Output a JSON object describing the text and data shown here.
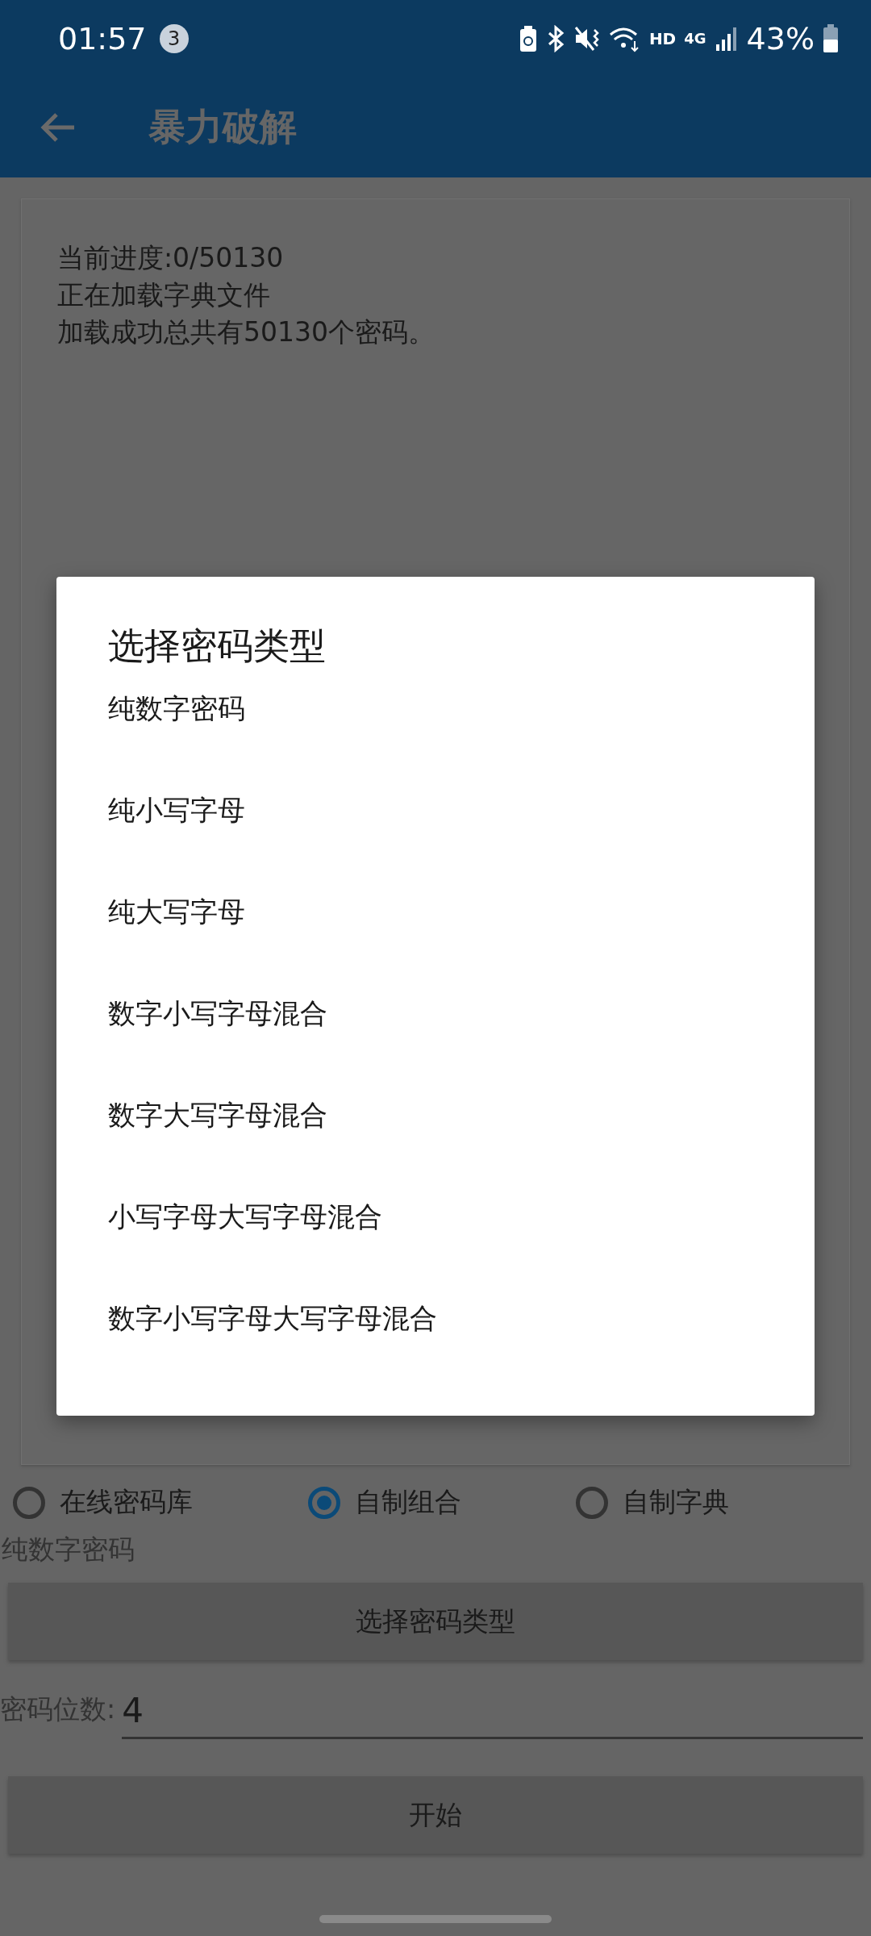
{
  "status_bar": {
    "time": "01:57",
    "notification_count": "3",
    "hd_label": "HD",
    "network_label": "4G",
    "battery_percent": "43%"
  },
  "app_bar": {
    "title": "暴力破解"
  },
  "log": {
    "lines": [
      "当前进度:0/50130",
      "正在加载字典文件",
      "加载成功总共有50130个密码。"
    ]
  },
  "source_options": [
    {
      "label": "在线密码库",
      "selected": false
    },
    {
      "label": "自制组合",
      "selected": true
    },
    {
      "label": "自制字典",
      "selected": false
    }
  ],
  "current_type": "纯数字密码",
  "select_type_button": "选择密码类型",
  "length_field": {
    "label": "密码位数:",
    "value": "4"
  },
  "start_button": "开始",
  "dialog": {
    "title": "选择密码类型",
    "items": [
      "纯数字密码",
      "纯小写字母",
      "纯大写字母",
      "数字小写字母混合",
      "数字大写字母混合",
      "小写字母大写字母混合",
      "数字小写字母大写字母混合"
    ]
  }
}
